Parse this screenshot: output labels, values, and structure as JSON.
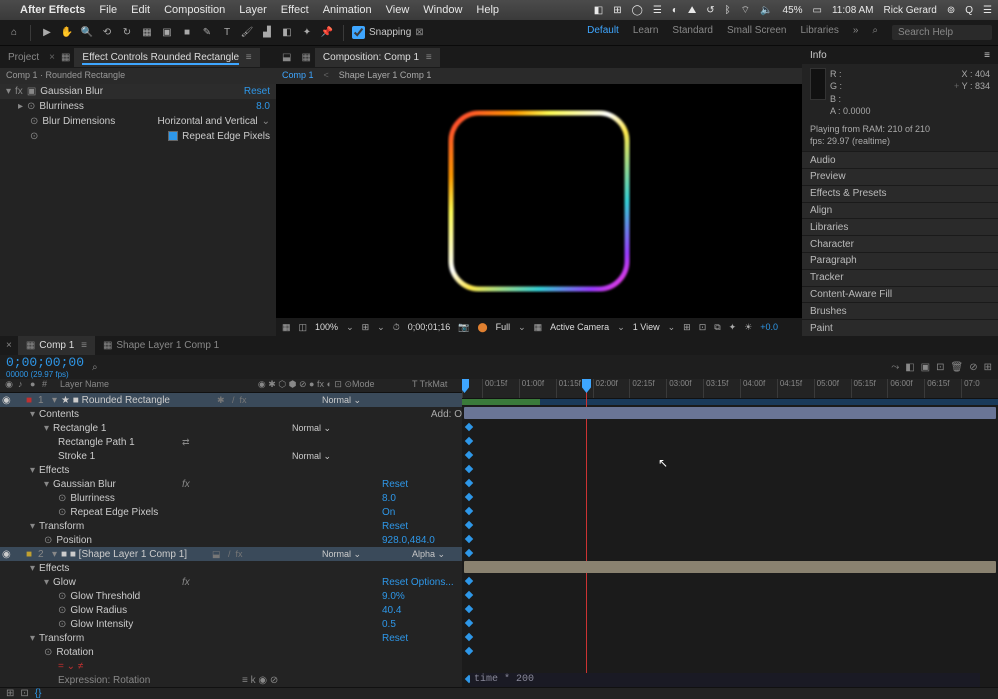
{
  "menubar": {
    "app": "After Effects",
    "items": [
      "File",
      "Edit",
      "Composition",
      "Layer",
      "Effect",
      "Animation",
      "View",
      "Window",
      "Help"
    ],
    "right": {
      "battery": "45%",
      "wifi": "",
      "time": "11:08 AM",
      "user": "Rick Gerard"
    }
  },
  "toolbar": {
    "snapping": "Snapping",
    "workspaces": [
      "Default",
      "Learn",
      "Standard",
      "Small Screen",
      "Libraries"
    ],
    "search_placeholder": "Search Help"
  },
  "effectControls": {
    "tab_project": "Project",
    "tab_fx": "Effect Controls Rounded Rectangle",
    "breadcrumb": "Comp 1 · Rounded Rectangle",
    "fx": {
      "name": "Gaussian Blur",
      "reset": "Reset",
      "props": [
        {
          "name": "Blurriness",
          "val": "8.0"
        },
        {
          "name": "Blur Dimensions",
          "val": "Horizontal and Vertical"
        },
        {
          "name": "",
          "val": "Repeat Edge Pixels",
          "check": true
        }
      ]
    }
  },
  "viewer": {
    "tab": "Composition: Comp 1",
    "crumb1": "Comp 1",
    "crumb2": "Shape Layer 1 Comp 1",
    "footer": {
      "zoom": "100%",
      "timecode": "0;00;01;16",
      "res": "Full",
      "camera": "Active Camera",
      "view": "1 View",
      "exposure": "+0.0"
    }
  },
  "info": {
    "title": "Info",
    "r": "R :",
    "g": "G :",
    "b": "B :",
    "a": "A :",
    "r_val": "",
    "g_val": "",
    "b_val": "",
    "a_val": "0.0000",
    "x": "X : 404",
    "y": "Y : 834",
    "status": "Playing from RAM: 210 of 210\nfps: 29.97 (realtime)"
  },
  "panels": [
    "Audio",
    "Preview",
    "Effects & Presets",
    "Align",
    "Libraries",
    "Character",
    "Paragraph",
    "Tracker",
    "Content-Aware Fill",
    "Brushes",
    "Paint"
  ],
  "timeline": {
    "tabs": [
      "Comp 1",
      "Shape Layer 1 Comp 1"
    ],
    "timecode": "0;00;00;00",
    "frame_label": "00000 (29.97 fps)",
    "columns": {
      "layer": "Layer Name",
      "mode": "Mode",
      "trkmat": "T   TrkMat"
    },
    "ruler": [
      "00:15f",
      "01:00f",
      "01:15f",
      "02:00f",
      "02:15f",
      "03:00f",
      "03:15f",
      "04:00f",
      "04:15f",
      "05:00f",
      "05:15f",
      "06:00f",
      "06:15f",
      "07:0"
    ],
    "layers": [
      {
        "idx": "1",
        "name": "★ ■ Rounded Rectangle",
        "mode": "Normal",
        "sel": true,
        "children": [
          {
            "name": "Contents",
            "right": "Add: O"
          },
          {
            "name": "Rectangle 1",
            "mode": "Normal",
            "depth": 1
          },
          {
            "name": "Rectangle Path 1",
            "depth": 2,
            "switches": "⇄"
          },
          {
            "name": "Stroke 1",
            "mode": "Normal",
            "depth": 2
          },
          {
            "name": "Effects"
          },
          {
            "name": "Gaussian Blur",
            "val": "Reset",
            "depth": 1,
            "fxswitch": true
          },
          {
            "name": "Blurriness",
            "val": "8.0",
            "depth": 2,
            "stopwatch": true
          },
          {
            "name": "Repeat Edge Pixels",
            "val": "On",
            "depth": 2,
            "stopwatch": true
          },
          {
            "name": "Transform",
            "val": "Reset"
          },
          {
            "name": "Position",
            "val": "928.0,484.0",
            "depth": 1,
            "stopwatch": true
          }
        ]
      },
      {
        "idx": "2",
        "name": "■ ■ [Shape Layer 1 Comp 1]",
        "mode": "Normal",
        "trkmat": "Alpha",
        "sel": true,
        "children": [
          {
            "name": "Effects"
          },
          {
            "name": "Glow",
            "val": "Reset   Options...",
            "depth": 1,
            "fxswitch": true
          },
          {
            "name": "Glow Threshold",
            "val": "9.0%",
            "depth": 2,
            "stopwatch": true
          },
          {
            "name": "Glow Radius",
            "val": "40.4",
            "depth": 2,
            "stopwatch": true
          },
          {
            "name": "Glow Intensity",
            "val": "0.5",
            "depth": 2,
            "stopwatch": true
          },
          {
            "name": "Transform",
            "val": "Reset"
          },
          {
            "name": "Rotation",
            "val": "",
            "depth": 1,
            "stopwatch": true,
            "expr": true
          },
          {
            "name": "Expression: Rotation",
            "depth": 2,
            "expression": "time * 200"
          }
        ]
      }
    ]
  }
}
